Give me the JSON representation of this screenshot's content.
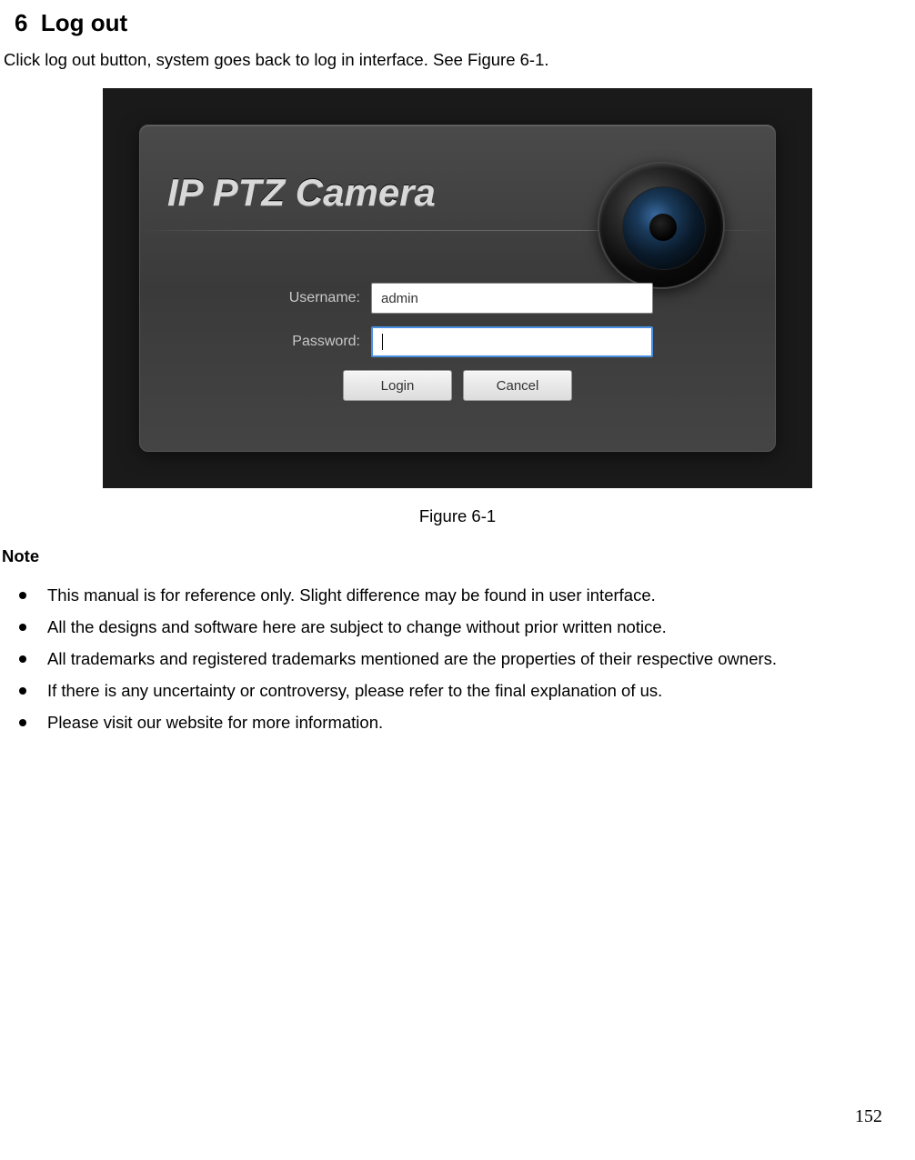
{
  "section": {
    "number": "6",
    "title": "Log out"
  },
  "intro_text": "Click log out button, system goes back to log in interface. See Figure 6-1.",
  "login_ui": {
    "brand": "IP PTZ Camera",
    "username_label": "Username:",
    "username_value": "admin",
    "password_label": "Password:",
    "password_value": "",
    "login_button": "Login",
    "cancel_button": "Cancel"
  },
  "figure_caption": "Figure 6-1",
  "note_heading": "Note",
  "notes": [
    "This manual is for reference only. Slight difference may be found in user interface.",
    "All the designs and software here are subject to change without prior written notice.",
    "All trademarks and registered trademarks mentioned are the properties of their respective owners.",
    "If there is any uncertainty or controversy, please refer to the final explanation of us.",
    "Please visit our website for more information."
  ],
  "page_number": "152"
}
